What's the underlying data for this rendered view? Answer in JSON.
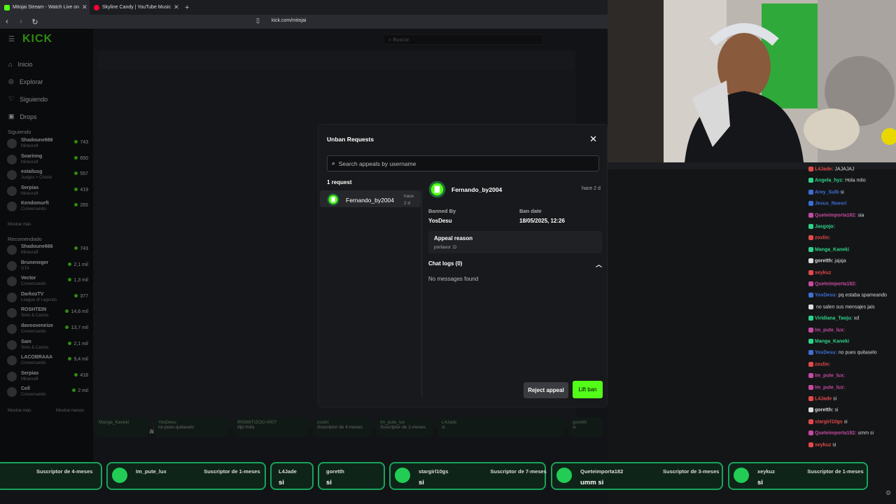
{
  "browser": {
    "tabs": [
      {
        "title": "Mitojai Stream - Watch Live on",
        "active": true,
        "favicon_color": "#53fc18"
      },
      {
        "title": "Skyline Candy | YouTube Music",
        "active": false,
        "favicon_color": "#ff0033"
      }
    ],
    "new_tab_icon": "plus-icon",
    "url": "kick.com/mitojai"
  },
  "site": {
    "logo": "KICK",
    "search_placeholder": "Buscar",
    "nav": [
      "Inicio",
      "Explorar",
      "Siguiendo",
      "Drops"
    ],
    "following_title": "Siguiendo",
    "following": [
      {
        "name": "Shadoune666",
        "game": "Minecraft",
        "viewers": "743"
      },
      {
        "name": "Soarinng",
        "game": "Minecraft",
        "viewers": "650"
      },
      {
        "name": "estailusg",
        "game": "Juegos + Charla",
        "viewers": "557"
      },
      {
        "name": "Serpias",
        "game": "Minecraft",
        "viewers": "419"
      },
      {
        "name": "Kendomurft",
        "game": "Conversando",
        "viewers": "265"
      }
    ],
    "show_less": "Mostrar más",
    "recommended_title": "Recomendado",
    "recommended": [
      {
        "name": "Shadoune666",
        "game": "Minecraft",
        "viewers": "743"
      },
      {
        "name": "Bruneneger",
        "game": "GTA",
        "viewers": "2,1 mil"
      },
      {
        "name": "Vector",
        "game": "Conversando",
        "viewers": "1,3 mil"
      },
      {
        "name": "DarkozTV",
        "game": "League of Legends",
        "viewers": "377"
      },
      {
        "name": "ROSHTEIN",
        "game": "Slots & Casino",
        "viewers": "14,6 mil"
      },
      {
        "name": "davooxeneize",
        "game": "Conversando",
        "viewers": "13,7 mil"
      },
      {
        "name": "Sam",
        "game": "Slots & Casino",
        "viewers": "2,1 mil"
      },
      {
        "name": "LACOBRAAA",
        "game": "Conversando",
        "viewers": "9,4 mil"
      },
      {
        "name": "Serpias",
        "game": "Minecraft",
        "viewers": "418"
      },
      {
        "name": "Cell",
        "game": "Conversando",
        "viewers": "2 mil"
      }
    ],
    "show_more": "Mostrar más",
    "show_less2": "Mostrar menos",
    "streamer_name": "Mitojai"
  },
  "modal": {
    "title": "Unban Requests",
    "search_placeholder": "Search appeals by username",
    "request_count": "1 request",
    "request": {
      "username": "Fernando_by2004",
      "time_line1": "hace",
      "time_line2": "2 d"
    },
    "detail": {
      "username": "Fernando_by2004",
      "time": "hace 2 d",
      "banned_by_label": "Banned By",
      "banned_by": "YosDesu",
      "ban_date_label": "Ban date",
      "ban_date": "18/05/2025, 12:26",
      "appeal_reason_label": "Appeal reason",
      "appeal_reason": "porfavor :D",
      "chat_logs_label": "Chat logs (0)",
      "no_messages": "No messages found"
    },
    "reject_label": "Reject appeal",
    "lift_label": "Lift ban",
    "accent": "#53fc18"
  },
  "chat": {
    "messages": [
      {
        "user": "L4Jade:",
        "text": "JAJAJAJ",
        "color": "#e34a4a"
      },
      {
        "user": "Angela_hyz:",
        "text": "Hola mito",
        "color": "#2fd38a"
      },
      {
        "user": "Arey_Sulb",
        "text": "si",
        "color": "#3f6fd6"
      },
      {
        "user": "Jesus_Nuesri",
        "text": "",
        "color": "#3f6fd6"
      },
      {
        "user": "Queteimporta182:",
        "text": "sia",
        "color": "#c44ba1"
      },
      {
        "user": "Jasgojo:",
        "text": "",
        "color": "#2fd38a"
      },
      {
        "user": "zoxlin:",
        "text": "",
        "color": "#e34a4a"
      },
      {
        "user": "Manga_Kaneki",
        "text": "",
        "color": "#2fd38a"
      },
      {
        "user": "goretth:",
        "text": "jajaja",
        "color": "#ddd"
      },
      {
        "user": "xeykuz",
        "text": "",
        "color": "#e34a4a"
      },
      {
        "user": "Queteimporta182:",
        "text": "",
        "color": "#c44ba1"
      },
      {
        "user": "YosDesu:",
        "text": "pq estaba spameando",
        "color": "#3f6fd6"
      },
      {
        "user": "",
        "text": "no salen sus mensajes jais",
        "color": "#ddd"
      },
      {
        "user": "Viridiana_Taoju:",
        "text": "xd",
        "color": "#2fd38a"
      },
      {
        "user": "Im_pute_lux:",
        "text": "",
        "color": "#c44ba1"
      },
      {
        "user": "Manga_Kaneki",
        "text": "",
        "color": "#2fd38a"
      },
      {
        "user": "YosDesu:",
        "text": "no pues quitaselo",
        "color": "#3f6fd6"
      },
      {
        "user": "zoxlin:",
        "text": "",
        "color": "#e34a4a"
      },
      {
        "user": "Im_pute_lux:",
        "text": "",
        "color": "#c44ba1"
      },
      {
        "user": "Im_pute_lux:",
        "text": "",
        "color": "#c44ba1"
      },
      {
        "user": "L4Jade",
        "text": "si",
        "color": "#e34a4a"
      },
      {
        "user": "goretth:",
        "text": "si",
        "color": "#ddd"
      },
      {
        "user": "stargirl10gs",
        "text": "si",
        "color": "#e34a4a"
      },
      {
        "user": "Queteimporta182:",
        "text": "umm si",
        "color": "#c44ba1"
      },
      {
        "user": "xeykuz",
        "text": "si",
        "color": "#e34a4a"
      }
    ]
  },
  "subs_under": [
    {
      "user": "Manga_Kaneki",
      "text": ""
    },
    {
      "user": "YosDesu",
      "text": "no pues quitaselo"
    },
    {
      "user": "IRISMITIZOO-0007",
      "text": "dijo hola"
    },
    {
      "user": "zoxlin",
      "text": "Suscriptor de 4-meses"
    },
    {
      "user": "Im_pute_lux",
      "text": "Suscriptor de 1-meses"
    },
    {
      "user": "L4Jade",
      "text": "si"
    },
    {
      "user": "goretth",
      "text": "si"
    },
    {
      "user": "stargirl10gs",
      "text": "Suscriptor de 7-meses"
    }
  ],
  "bottom_subs": [
    {
      "user": "",
      "sub": "Suscriptor de 4-meses",
      "msg": ""
    },
    {
      "user": "Im_pute_lux",
      "sub": "Suscriptor de 1-meses",
      "msg": ""
    },
    {
      "user": "L4Jade",
      "sub": "",
      "msg": "si"
    },
    {
      "user": "goretth",
      "sub": "",
      "msg": "si"
    },
    {
      "user": "stargirl10gs",
      "sub": "Suscriptor de 7-meses",
      "msg": "si"
    },
    {
      "user": "Queteimporta182",
      "sub": "Suscriptor de 3-meses",
      "msg": "umm si"
    },
    {
      "user": "xeykuz",
      "sub": "Suscriptor de 1-meses",
      "msg": "si"
    }
  ]
}
